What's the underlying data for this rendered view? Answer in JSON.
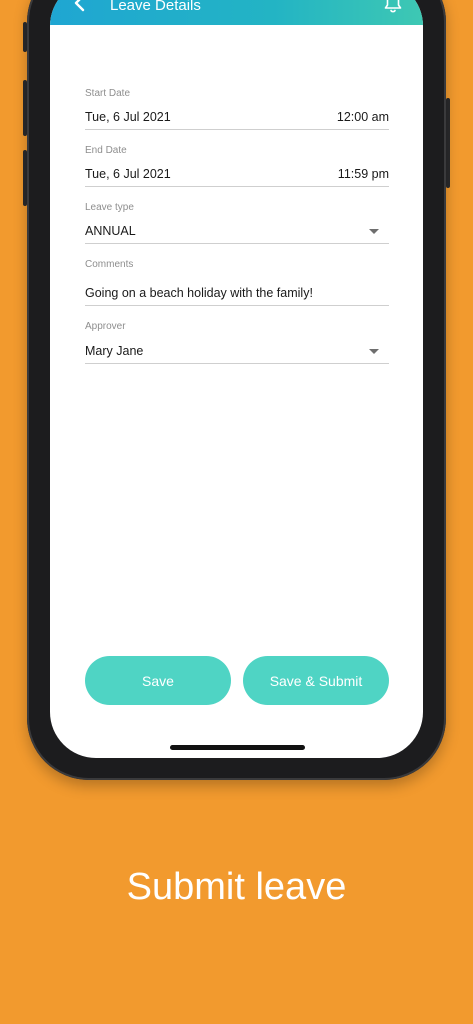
{
  "header": {
    "title": "Leave Details",
    "back_icon": "chevron-left-icon",
    "bell_icon": "bell-icon",
    "gradient": [
      "#1fa6d2",
      "#3ec8b3"
    ]
  },
  "form": {
    "start_date": {
      "label": "Start Date",
      "date": "Tue, 6 Jul 2021",
      "time": "12:00 am"
    },
    "end_date": {
      "label": "End Date",
      "date": "Tue, 6 Jul 2021",
      "time": "11:59 pm"
    },
    "leave_type": {
      "label": "Leave type",
      "value": "ANNUAL"
    },
    "comments": {
      "label": "Comments",
      "value": "Going on a beach holiday with the family!"
    },
    "approver": {
      "label": "Approver",
      "value": "Mary Jane"
    }
  },
  "actions": {
    "save_label": "Save",
    "save_submit_label": "Save & Submit",
    "button_color": "#4FD4C4"
  },
  "caption": "Submit leave",
  "colors": {
    "background": "#F29A2E"
  }
}
